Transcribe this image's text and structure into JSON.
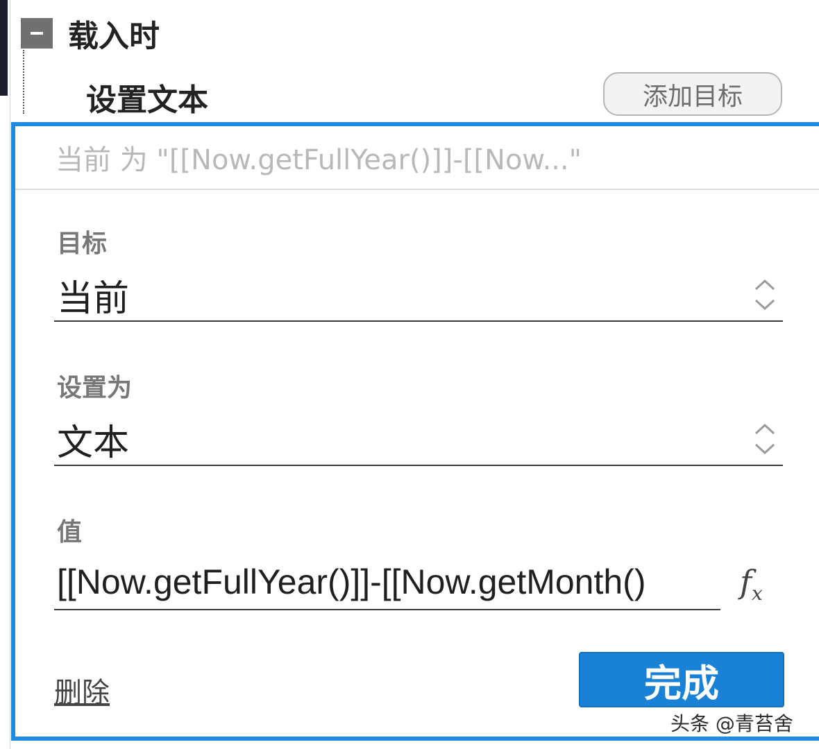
{
  "event": {
    "title": "载入时"
  },
  "action": {
    "title": "设置文本",
    "add_target_label": "添加目标"
  },
  "panel": {
    "summary": "当前 为 \"[[Now.getFullYear()]]-[[Now...\"",
    "target": {
      "label": "目标",
      "value": "当前"
    },
    "set_to": {
      "label": "设置为",
      "value": "文本"
    },
    "value_field": {
      "label": "值",
      "value": "[[Now.getFullYear()]]-[[Now.getMonth()"
    },
    "fx_icon": "fx-icon",
    "delete_label": "删除",
    "done_label": "完成"
  },
  "watermark": "头条 @青苔舍",
  "colors": {
    "accent": "#1e8be0",
    "button": "#1a82d6"
  }
}
